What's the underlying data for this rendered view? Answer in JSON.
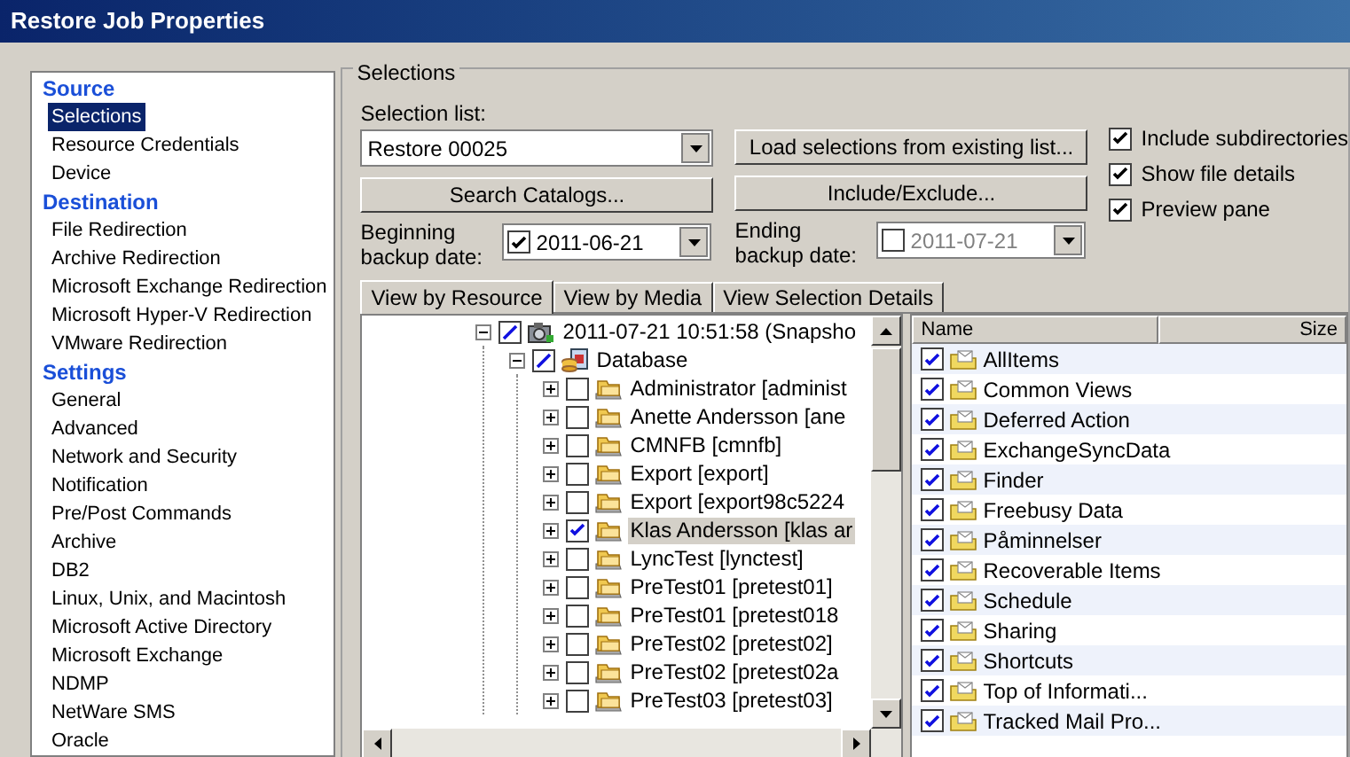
{
  "window": {
    "title": "Restore Job Properties"
  },
  "sidebar": {
    "sections": [
      {
        "heading": "Source",
        "items": [
          {
            "label": "Selections",
            "selected": true
          },
          {
            "label": "Resource Credentials",
            "selected": false
          },
          {
            "label": "Device",
            "selected": false
          }
        ]
      },
      {
        "heading": "Destination",
        "items": [
          {
            "label": "File Redirection",
            "selected": false
          },
          {
            "label": "Archive Redirection",
            "selected": false
          },
          {
            "label": "Microsoft Exchange Redirection",
            "selected": false
          },
          {
            "label": "Microsoft Hyper-V Redirection",
            "selected": false
          },
          {
            "label": "VMware Redirection",
            "selected": false
          }
        ]
      },
      {
        "heading": "Settings",
        "items": [
          {
            "label": "General",
            "selected": false
          },
          {
            "label": "Advanced",
            "selected": false
          },
          {
            "label": "Network and Security",
            "selected": false
          },
          {
            "label": "Notification",
            "selected": false
          },
          {
            "label": "Pre/Post Commands",
            "selected": false
          },
          {
            "label": "Archive",
            "selected": false
          },
          {
            "label": "DB2",
            "selected": false
          },
          {
            "label": "Linux, Unix, and Macintosh",
            "selected": false
          },
          {
            "label": "Microsoft Active Directory",
            "selected": false
          },
          {
            "label": "Microsoft Exchange",
            "selected": false
          },
          {
            "label": "NDMP",
            "selected": false
          },
          {
            "label": "NetWare SMS",
            "selected": false
          },
          {
            "label": "Oracle",
            "selected": false
          }
        ]
      }
    ]
  },
  "selections": {
    "title": "Selections",
    "selection_list": {
      "label": "Selection list:",
      "value": "Restore 00025"
    },
    "load_button": "Load selections from existing list...",
    "search_button": "Search Catalogs...",
    "include_button": "Include/Exclude...",
    "beginning_date": {
      "label": "Beginning backup date:",
      "value": "2011-06-21",
      "checked": true
    },
    "ending_date": {
      "label": "Ending backup date:",
      "value": "2011-07-21",
      "checked": false
    },
    "options": [
      {
        "label": "Include subdirectories",
        "checked": true
      },
      {
        "label": "Show file details",
        "checked": true
      },
      {
        "label": "Preview pane",
        "checked": true
      }
    ],
    "tabs": [
      {
        "label": "View by Resource",
        "selected": true
      },
      {
        "label": "View by Media",
        "selected": false
      },
      {
        "label": "View Selection Details",
        "selected": false
      }
    ],
    "tree": [
      {
        "label": "2011-07-21 10:51:58 (Snapsho",
        "kind": "snapshot",
        "checked": true,
        "partial": true,
        "expanded": true,
        "selected": false,
        "children": [
          {
            "label": "Database",
            "kind": "database",
            "checked": true,
            "partial": true,
            "expanded": true,
            "selected": false,
            "children": [
              {
                "label": "Administrator [administ",
                "kind": "mailbox",
                "checked": false,
                "partial": false,
                "expanded": false,
                "selected": false
              },
              {
                "label": "Anette Andersson [ane",
                "kind": "mailbox",
                "checked": false,
                "partial": false,
                "expanded": false,
                "selected": false
              },
              {
                "label": "CMNFB [cmnfb]",
                "kind": "mailbox",
                "checked": false,
                "partial": false,
                "expanded": false,
                "selected": false
              },
              {
                "label": "Export [export]",
                "kind": "mailbox",
                "checked": false,
                "partial": false,
                "expanded": false,
                "selected": false
              },
              {
                "label": "Export [export98c5224",
                "kind": "mailbox",
                "checked": false,
                "partial": false,
                "expanded": false,
                "selected": false
              },
              {
                "label": "Klas Andersson [klas ar",
                "kind": "mailbox",
                "checked": true,
                "partial": false,
                "expanded": false,
                "selected": true
              },
              {
                "label": "LyncTest [lynctest]",
                "kind": "mailbox",
                "checked": false,
                "partial": false,
                "expanded": false,
                "selected": false
              },
              {
                "label": "PreTest01 [pretest01]",
                "kind": "mailbox",
                "checked": false,
                "partial": false,
                "expanded": false,
                "selected": false
              },
              {
                "label": "PreTest01 [pretest018",
                "kind": "mailbox",
                "checked": false,
                "partial": false,
                "expanded": false,
                "selected": false
              },
              {
                "label": "PreTest02 [pretest02]",
                "kind": "mailbox",
                "checked": false,
                "partial": false,
                "expanded": false,
                "selected": false
              },
              {
                "label": "PreTest02 [pretest02a",
                "kind": "mailbox",
                "checked": false,
                "partial": false,
                "expanded": false,
                "selected": false
              },
              {
                "label": "PreTest03 [pretest03]",
                "kind": "mailbox",
                "checked": false,
                "partial": false,
                "expanded": false,
                "selected": false
              }
            ]
          }
        ]
      }
    ],
    "list": {
      "columns": [
        "Name",
        "Size"
      ],
      "rows": [
        {
          "name": "AllItems",
          "checked": true
        },
        {
          "name": "Common Views",
          "checked": true
        },
        {
          "name": "Deferred Action",
          "checked": true
        },
        {
          "name": "ExchangeSyncData",
          "checked": true
        },
        {
          "name": "Finder",
          "checked": true
        },
        {
          "name": "Freebusy Data",
          "checked": true
        },
        {
          "name": "Påminnelser",
          "checked": true
        },
        {
          "name": "Recoverable Items",
          "checked": true
        },
        {
          "name": "Schedule",
          "checked": true
        },
        {
          "name": "Sharing",
          "checked": true
        },
        {
          "name": "Shortcuts",
          "checked": true
        },
        {
          "name": "Top of Informati...",
          "checked": true
        },
        {
          "name": "Tracked Mail Pro...",
          "checked": true
        }
      ]
    }
  }
}
